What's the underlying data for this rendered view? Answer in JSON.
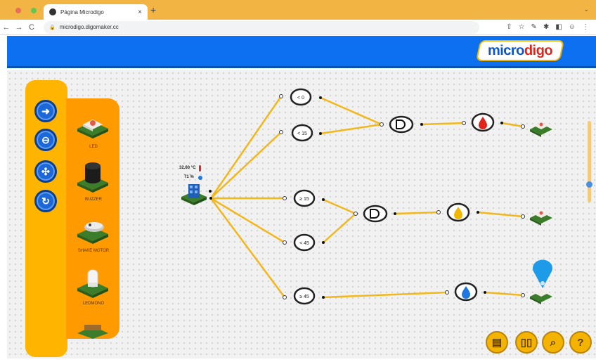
{
  "browser": {
    "tab_title": "Página Microdigo",
    "tab_close": "×",
    "new_tab": "+",
    "url": "microdigo.digomaker.cc",
    "lock_icon": "🔒",
    "nav": {
      "back": "←",
      "forward": "→",
      "reload": "C"
    },
    "toolbar_icons": [
      "⇧",
      "☆",
      "✎",
      "✱",
      "◧",
      "☺",
      "⋮"
    ]
  },
  "header": {
    "logo_a": "micro",
    "logo_b": "digo"
  },
  "palette": {
    "nav_icons": [
      "arrow-right-circle-icon",
      "minus-circle-icon",
      "hub-icon",
      "rotate-circle-icon"
    ],
    "items": [
      {
        "label": "LED"
      },
      {
        "label": "BUZZER"
      },
      {
        "label": "SHAKE MOTOR"
      },
      {
        "label": "LEDMONO"
      }
    ]
  },
  "sensor": {
    "temperature": "32.60 °C",
    "humidity": "71 %"
  },
  "conditions": [
    {
      "label": "< 0"
    },
    {
      "label": "< 15"
    },
    {
      "label": "≥ 15"
    },
    {
      "label": "< 45"
    },
    {
      "label": "≥ 45"
    }
  ],
  "bottom_buttons": [
    "notes-icon",
    "book-icon",
    "magnifier-icon",
    "help-icon"
  ],
  "help_label": "?",
  "colors": {
    "header": "#0d70f1",
    "wire": "#f2b71c",
    "palette_yellow": "#ffb400",
    "palette_orange": "#ff9b00",
    "tab_strip": "#f2b544"
  }
}
